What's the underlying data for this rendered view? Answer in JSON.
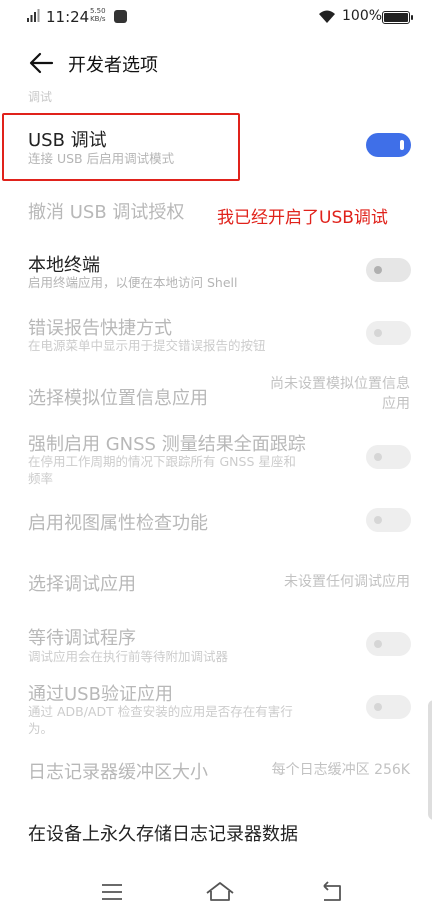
{
  "status_bar": {
    "time": "11:24",
    "speed_value": "5.50",
    "speed_unit": "KB/s",
    "battery": "100%"
  },
  "header": {
    "title": "开发者选项"
  },
  "partial_text": "调试",
  "settings": {
    "usb_debug": {
      "title": "USB 调试",
      "subtitle": "连接 USB 后启用调试模式",
      "state": "on"
    },
    "revoke_usb": {
      "title": "撤消 USB 调试授权"
    },
    "local_terminal": {
      "title": "本地终端",
      "subtitle": "启用终端应用，以便在本地访问 Shell",
      "state": "off"
    },
    "bug_report": {
      "title": "错误报告快捷方式",
      "subtitle": "在电源菜单中显示用于提交错误报告的按钮",
      "state": "off-disabled"
    },
    "mock_location": {
      "title": "选择模拟位置信息应用",
      "value_line1": "尚未设置模拟位置信息",
      "value_line2": "应用"
    },
    "gnss": {
      "title": "强制启用 GNSS 测量结果全面跟踪",
      "subtitle_line1": "在停用工作周期的情况下跟踪所有 GNSS 星座和",
      "subtitle_line2": "频率",
      "state": "off-disabled"
    },
    "view_attr": {
      "title": "启用视图属性检查功能",
      "state": "off-disabled"
    },
    "debug_app": {
      "title": "选择调试应用",
      "value": "未设置任何调试应用"
    },
    "wait_debugger": {
      "title": "等待调试程序",
      "subtitle": "调试应用会在执行前等待附加调试器",
      "state": "off-disabled"
    },
    "verify_usb": {
      "title": "通过USB验证应用",
      "subtitle_line1": "通过 ADB/ADT 检查安装的应用是否存在有害行",
      "subtitle_line2": "为。",
      "state": "off-disabled"
    },
    "logger_buffer": {
      "title": "日志记录器缓冲区大小",
      "value": "每个日志缓冲区 256K"
    },
    "persist_logs": {
      "title": "在设备上永久存储日志记录器数据"
    }
  },
  "annotation": "我已经开启了USB调试",
  "colors": {
    "accent": "#3f6fe8",
    "annotation_red": "#e0221b"
  }
}
